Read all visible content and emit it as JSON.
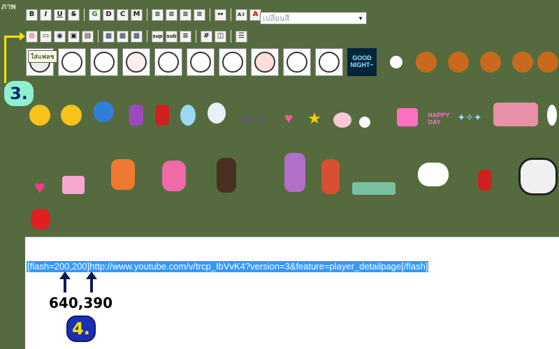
{
  "header": {
    "corner_label": "ภาพ"
  },
  "toolbar": {
    "row1": [
      "B",
      "I",
      "U",
      "S",
      "G",
      "D",
      "C",
      "M",
      "≡",
      "≡",
      "≡",
      "≡",
      "↔",
      "A↕",
      "A"
    ],
    "row2": [
      "◎",
      "▭",
      "◉",
      "▣",
      "▤",
      "▦",
      "▦",
      "▦",
      "sup",
      "sub",
      "≡",
      "#",
      "◫",
      "☰"
    ],
    "color_select": "เปลี่ยนสี"
  },
  "emoticons": {
    "tooltip": "ใส่แฟลช",
    "good_night": [
      "GOOD",
      "NIGHT~"
    ]
  },
  "annotations": {
    "step3": "3.",
    "step4": "4.",
    "size_note": "640,390"
  },
  "editor": {
    "content": "[flash=200,200]http://www.youtube.com/v/trcp_IbVvK4?version=3&feature=player_detailpage[/flash]"
  },
  "colors": {
    "background": "#556b3f",
    "highlight": "#3399ff",
    "marker_yellow": "#f5e300",
    "step3_bg": "#8ef0d0",
    "step4_bg": "#1b2fb5"
  }
}
